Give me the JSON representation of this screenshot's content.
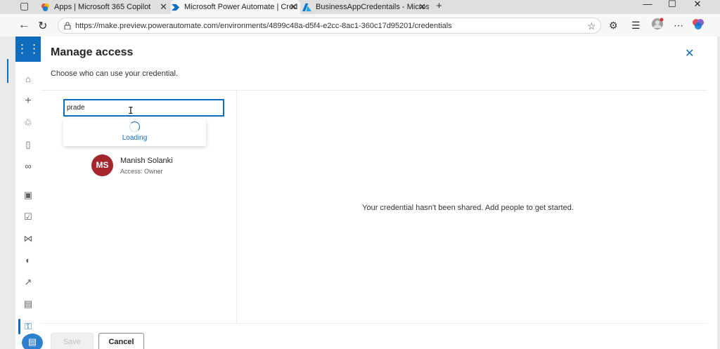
{
  "browser": {
    "tabs": [
      {
        "title": "Apps | Microsoft 365 Copilot",
        "active": false,
        "icon": "copilot-icon"
      },
      {
        "title": "Microsoft Power Automate | Cred",
        "active": true,
        "icon": "power-automate-icon"
      },
      {
        "title": "BusinessAppCredentails - Micros",
        "active": false,
        "icon": "azure-icon"
      }
    ],
    "new_tab_glyph": "+",
    "url": "https://make.preview.powerautomate.com/environments/4899c48a-d5f4-e2cc-8ac1-360c17d95201/credentials"
  },
  "rail": {
    "items": [
      "home-icon",
      "create-icon",
      "templates-icon",
      "learn-icon",
      "connectors-icon",
      "my-flows-icon",
      "approvals-icon",
      "solutions-icon",
      "process-mining-icon",
      "monitor-icon",
      "desktop-flows-icon",
      "credentials-icon"
    ]
  },
  "panel": {
    "title": "Manage access",
    "description": "Choose who can use your credential.",
    "search": {
      "value": "prade",
      "placeholder": ""
    },
    "suggestions": {
      "loading_text": "Loading"
    },
    "owner": {
      "initials": "MS",
      "name": "Manish Solanki",
      "access": "Access: Owner",
      "avatar_color": "#a4262c"
    },
    "empty_message": "Your credential hasn't been shared. Add people to get started.",
    "save_label": "Save",
    "cancel_label": "Cancel"
  },
  "colors": {
    "accent": "#0f6cbd"
  }
}
